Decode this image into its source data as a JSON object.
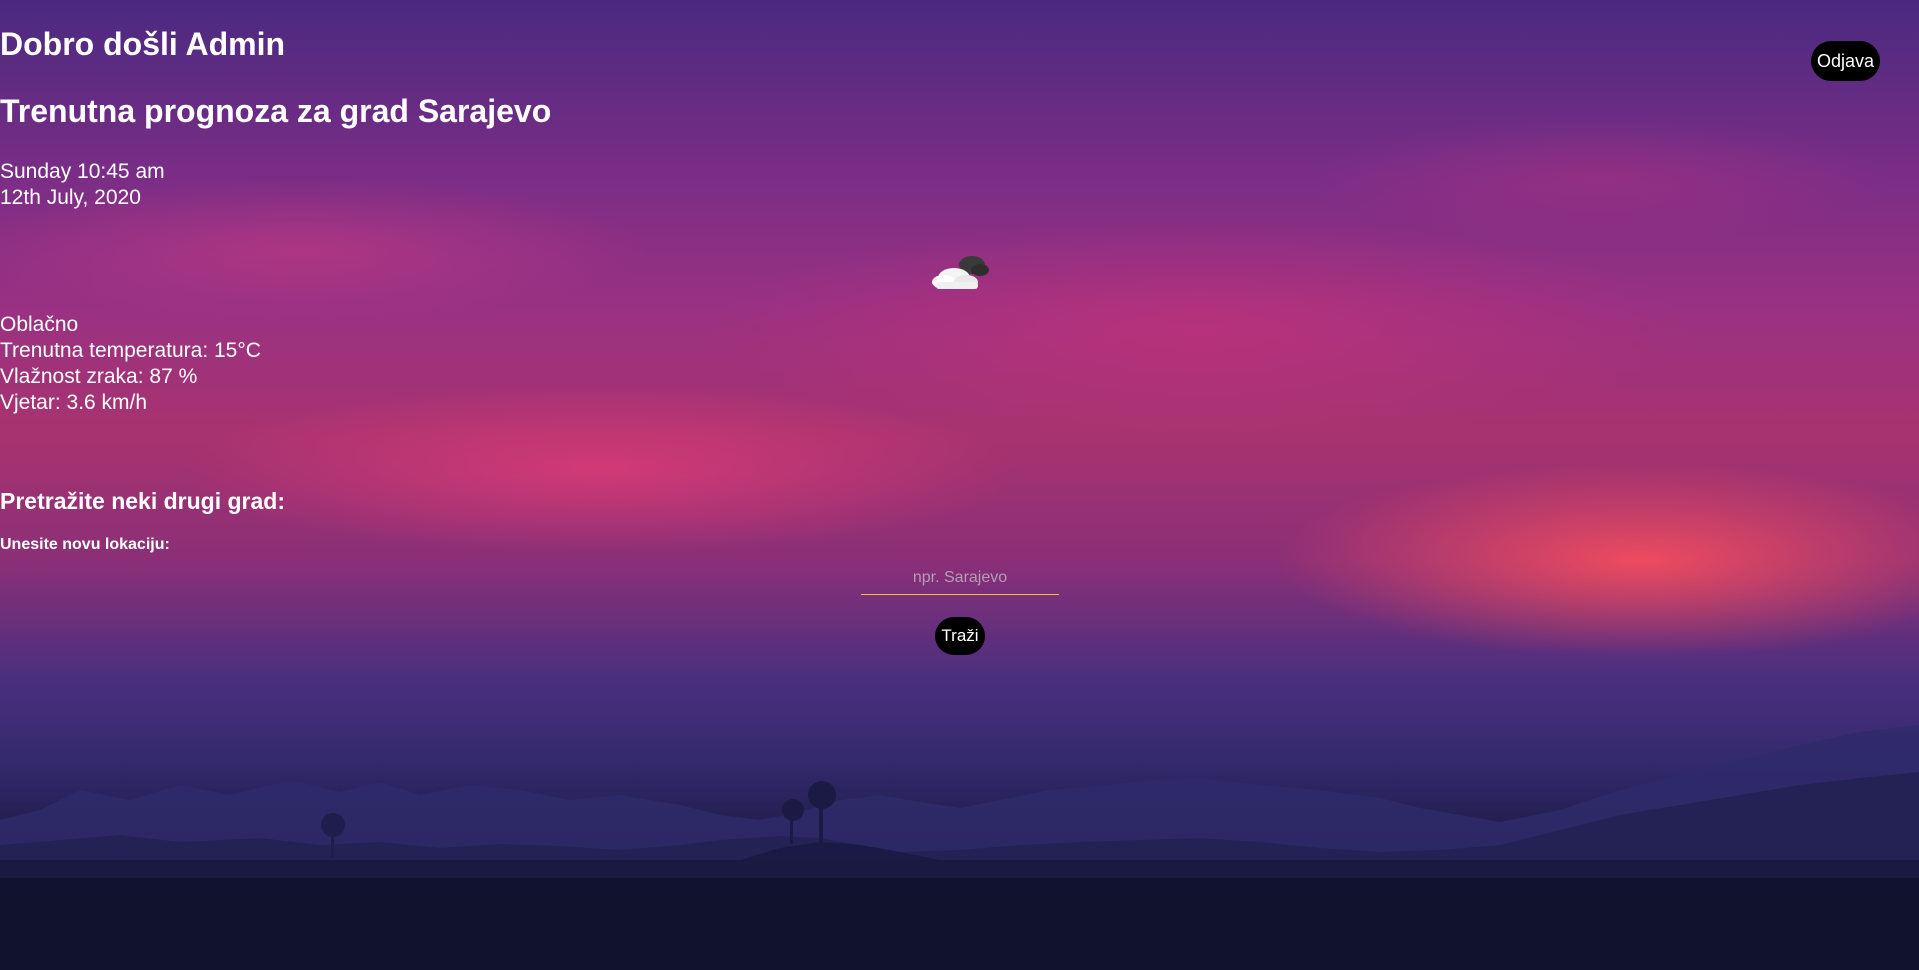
{
  "header": {
    "welcome": "Dobro došli Admin",
    "forecast_title": "Trenutna prognoza za grad Sarajevo",
    "logout_label": "Odjava"
  },
  "datetime": {
    "time": "Sunday 10:45 am",
    "date": "12th July, 2020"
  },
  "weather": {
    "icon": "partly-cloudy-icon",
    "condition": "Oblačno",
    "temperature": "Trenutna temperatura: 15°C",
    "humidity": "Vlažnost zraka: 87 %",
    "wind": "Vjetar: 3.6 km/h"
  },
  "search": {
    "title": "Pretražite neki drugi grad:",
    "label": "Unesite novu lokaciju:",
    "placeholder": "npr. Sarajevo",
    "value": "",
    "button_label": "Traži"
  },
  "colors": {
    "accent_underline": "#f2c230",
    "button_bg": "#000000",
    "text": "#ffffff"
  }
}
